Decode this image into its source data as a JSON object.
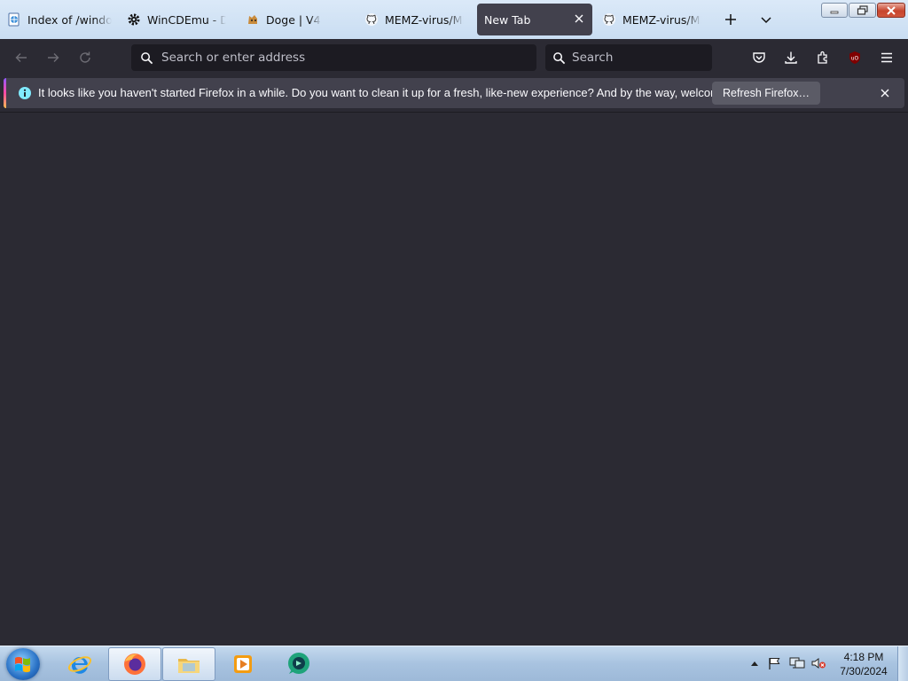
{
  "tabs": [
    {
      "title": "Index of /windov",
      "icon": "web-page-icon",
      "active": false
    },
    {
      "title": "WinCDEmu - Do",
      "icon": "gear-icon",
      "active": false
    },
    {
      "title": "Doge | V4",
      "icon": "doge-icon",
      "active": false
    },
    {
      "title": "MEMZ-virus/ME",
      "icon": "github-icon",
      "active": false
    },
    {
      "title": "New Tab",
      "icon": "none",
      "active": true
    },
    {
      "title": "MEMZ-virus/ME",
      "icon": "github-icon",
      "active": false
    }
  ],
  "tabstrip": {
    "new_tab_icon": "plus-icon",
    "list_all_tabs_icon": "chevron-down-icon"
  },
  "window_controls": [
    "minimize-icon",
    "restore-icon",
    "close-icon"
  ],
  "navbar": {
    "back_icon": "back-arrow-icon",
    "forward_icon": "forward-arrow-icon",
    "reload_icon": "reload-icon",
    "url_placeholder": "Search or enter address",
    "url_value": "",
    "search_placeholder": "Search",
    "search_value": "",
    "toolbar_icons": [
      "pocket-icon",
      "download-icon",
      "extensions-icon",
      "ublock-origin-icon",
      "menu-icon"
    ]
  },
  "notification": {
    "message": "It looks like you haven't started Firefox in a while. Do you want to clean it up for a fresh, like-new experience? And by the way, welcome back!",
    "button_label": "Refresh Firefox…",
    "icon": "info-icon",
    "close_icon": "close-icon"
  },
  "taskbar": {
    "pinned": [
      {
        "name": "internet-explorer-icon",
        "open": false
      },
      {
        "name": "firefox-icon",
        "open": true
      },
      {
        "name": "file-explorer-icon",
        "open": true
      },
      {
        "name": "media-player-icon",
        "open": false
      },
      {
        "name": "chat-app-icon",
        "open": false
      }
    ],
    "tray_icons": [
      "show-hidden-icons-icon",
      "action-center-flag-icon",
      "network-icon",
      "volume-muted-icon"
    ],
    "time": "4:18 PM",
    "date": "7/30/2024"
  },
  "colors": {
    "toolbar_bg": "#2b2a33",
    "field_bg": "#1c1b22",
    "active_tab_bg": "#42414d",
    "notification_bg": "#42414d",
    "text_light": "#fbfbfe",
    "tabstrip_bg": "#d4e4f6"
  }
}
